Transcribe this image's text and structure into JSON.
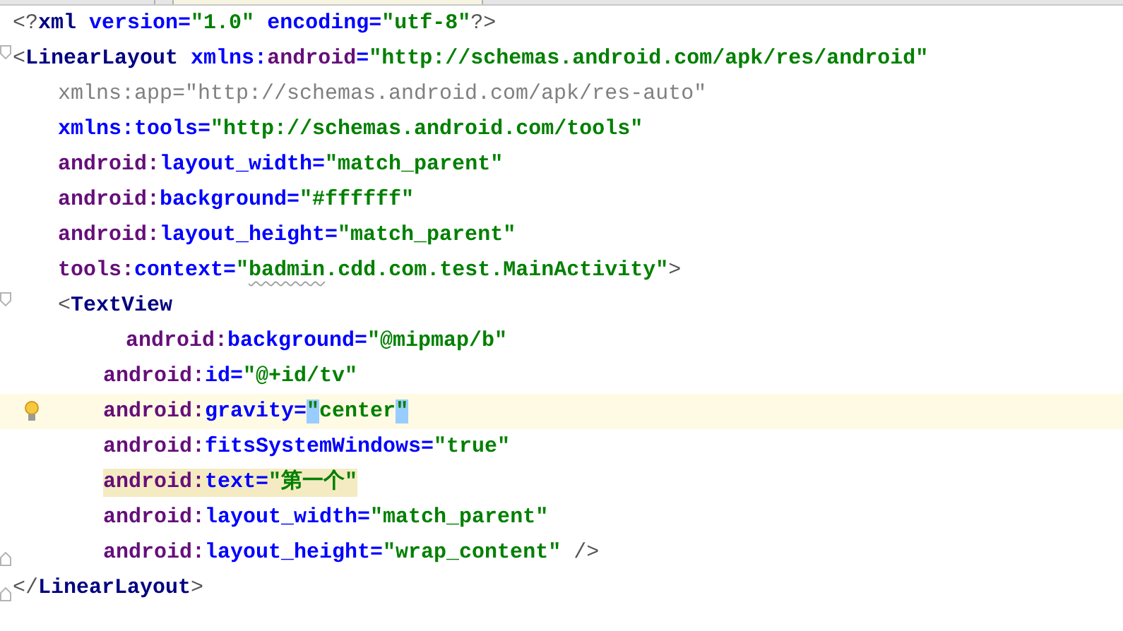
{
  "editor": {
    "lines": [
      {
        "kind": "top",
        "fold_start": false,
        "fold_end": false,
        "current": false,
        "highlighted": false,
        "bulb": false,
        "tokens": [
          {
            "kind": "bracket",
            "text": "<?"
          },
          {
            "kind": "tag",
            "text": "xml"
          },
          {
            "kind": "attr",
            "text": " version="
          },
          {
            "kind": "value",
            "text": "\"1.0\""
          },
          {
            "kind": "attr",
            "text": " encoding="
          },
          {
            "kind": "value",
            "text": "\"utf-8\""
          },
          {
            "kind": "bracket",
            "text": "?>"
          }
        ]
      },
      {
        "kind": "top",
        "fold_start": true,
        "fold_end": false,
        "current": false,
        "highlighted": false,
        "bulb": false,
        "tokens": [
          {
            "kind": "bracket",
            "text": "<"
          },
          {
            "kind": "tag",
            "text": "LinearLayout"
          },
          {
            "kind": "attr",
            "text": " xmlns:"
          },
          {
            "kind": "ns",
            "text": "android"
          },
          {
            "kind": "attr",
            "text": "="
          },
          {
            "kind": "value",
            "text": "\"http://schemas.android.com/apk/res/android\""
          }
        ]
      },
      {
        "kind": "attr",
        "fold_start": false,
        "fold_end": false,
        "current": false,
        "highlighted": false,
        "bulb": false,
        "tokens": [
          {
            "kind": "unused",
            "text": "xmlns:app=\"http://schemas.android.com/apk/res-auto\""
          }
        ]
      },
      {
        "kind": "attr",
        "fold_start": false,
        "fold_end": false,
        "current": false,
        "highlighted": false,
        "bulb": false,
        "tokens": [
          {
            "kind": "attr",
            "text": "xmlns:tools="
          },
          {
            "kind": "value",
            "text": "\"http://schemas.android.com/tools\""
          }
        ]
      },
      {
        "kind": "attr",
        "fold_start": false,
        "fold_end": false,
        "current": false,
        "highlighted": false,
        "bulb": false,
        "tokens": [
          {
            "kind": "ns",
            "text": "android:"
          },
          {
            "kind": "attr",
            "text": "layout_width="
          },
          {
            "kind": "value",
            "text": "\"match_parent\""
          }
        ]
      },
      {
        "kind": "attr",
        "fold_start": false,
        "fold_end": false,
        "current": false,
        "highlighted": false,
        "bulb": false,
        "tokens": [
          {
            "kind": "ns",
            "text": "android:"
          },
          {
            "kind": "attr",
            "text": "background="
          },
          {
            "kind": "value",
            "text": "\"#ffffff\""
          }
        ]
      },
      {
        "kind": "attr",
        "fold_start": false,
        "fold_end": false,
        "current": false,
        "highlighted": false,
        "bulb": false,
        "tokens": [
          {
            "kind": "ns",
            "text": "android:"
          },
          {
            "kind": "attr",
            "text": "layout_height="
          },
          {
            "kind": "value",
            "text": "\"match_parent\""
          }
        ]
      },
      {
        "kind": "attr",
        "fold_start": false,
        "fold_end": false,
        "current": false,
        "highlighted": false,
        "bulb": false,
        "tokens": [
          {
            "kind": "ns",
            "text": "tools:"
          },
          {
            "kind": "attr",
            "text": "context="
          },
          {
            "kind": "value",
            "text": "\""
          },
          {
            "kind": "typo",
            "text": "badmin"
          },
          {
            "kind": "value",
            "text": ".cdd.com.test.MainActivity\""
          },
          {
            "kind": "bracket",
            "text": ">"
          }
        ]
      },
      {
        "kind": "attr",
        "fold_start": true,
        "fold_end": false,
        "current": false,
        "highlighted": false,
        "bulb": false,
        "tokens": [
          {
            "kind": "bracket",
            "text": "<"
          },
          {
            "kind": "tag",
            "text": "TextView"
          }
        ]
      },
      {
        "kind": "deep",
        "fold_start": false,
        "fold_end": false,
        "current": false,
        "highlighted": false,
        "bulb": false,
        "tokens": [
          {
            "kind": "ns",
            "text": "android:"
          },
          {
            "kind": "attr",
            "text": "background="
          },
          {
            "kind": "value",
            "text": "\"@mipmap/b\""
          }
        ]
      },
      {
        "kind": "child",
        "fold_start": false,
        "fold_end": false,
        "current": false,
        "highlighted": false,
        "bulb": false,
        "tokens": [
          {
            "kind": "ns",
            "text": "android:"
          },
          {
            "kind": "attr",
            "text": "id="
          },
          {
            "kind": "value",
            "text": "\"@+id/tv\""
          }
        ]
      },
      {
        "kind": "child",
        "fold_start": false,
        "fold_end": false,
        "current": true,
        "highlighted": false,
        "bulb": true,
        "tokens": [
          {
            "kind": "ns",
            "text": "android:"
          },
          {
            "kind": "attr",
            "text": "gravity="
          },
          {
            "kind": "match-quote",
            "text": "\""
          },
          {
            "kind": "value",
            "text": "center"
          },
          {
            "kind": "match-quote",
            "text": "\""
          }
        ]
      },
      {
        "kind": "child",
        "fold_start": false,
        "fold_end": false,
        "current": false,
        "highlighted": false,
        "bulb": false,
        "tokens": [
          {
            "kind": "ns",
            "text": "android:"
          },
          {
            "kind": "attr",
            "text": "fitsSystemWindows="
          },
          {
            "kind": "value",
            "text": "\"true\""
          }
        ]
      },
      {
        "kind": "child",
        "fold_start": false,
        "fold_end": false,
        "current": false,
        "highlighted": true,
        "bulb": false,
        "tokens": [
          {
            "kind": "ns",
            "text": "android:"
          },
          {
            "kind": "attr",
            "text": "text="
          },
          {
            "kind": "value",
            "text": "\"第一个\""
          }
        ]
      },
      {
        "kind": "child",
        "fold_start": false,
        "fold_end": false,
        "current": false,
        "highlighted": false,
        "bulb": false,
        "tokens": [
          {
            "kind": "ns",
            "text": "android:"
          },
          {
            "kind": "attr",
            "text": "layout_width="
          },
          {
            "kind": "value",
            "text": "\"match_parent\""
          }
        ]
      },
      {
        "kind": "child",
        "fold_start": false,
        "fold_end": true,
        "current": false,
        "highlighted": false,
        "bulb": false,
        "tokens": [
          {
            "kind": "ns",
            "text": "android:"
          },
          {
            "kind": "attr",
            "text": "layout_height="
          },
          {
            "kind": "value",
            "text": "\"wrap_content\""
          },
          {
            "kind": "bracket",
            "text": " />"
          }
        ]
      },
      {
        "kind": "top",
        "fold_start": false,
        "fold_end": true,
        "current": false,
        "highlighted": false,
        "bulb": false,
        "tokens": [
          {
            "kind": "bracket",
            "text": "</"
          },
          {
            "kind": "tag",
            "text": "LinearLayout"
          },
          {
            "kind": "bracket",
            "text": ">"
          }
        ]
      }
    ]
  }
}
